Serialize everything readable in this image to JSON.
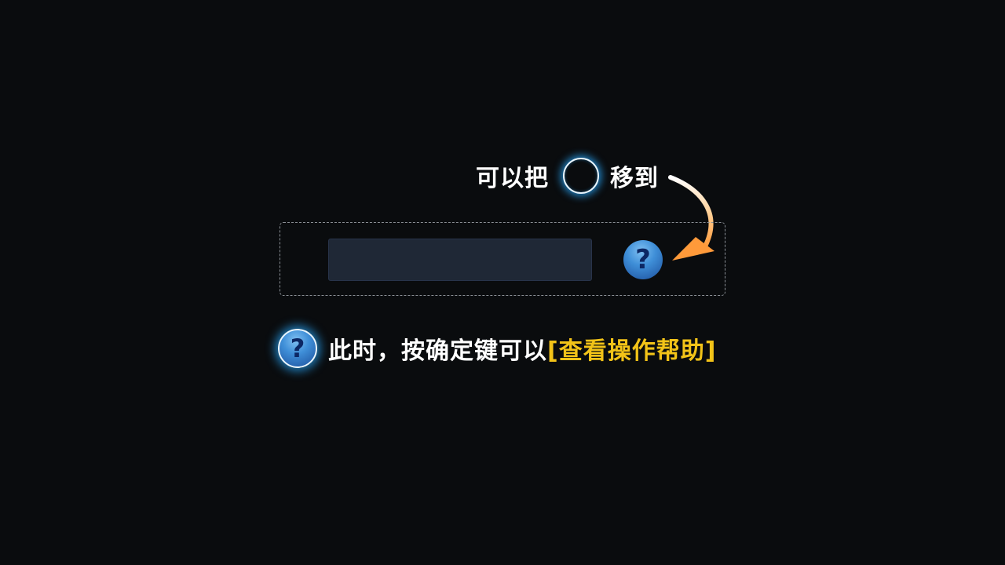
{
  "top_hint": {
    "prefix": "可以把",
    "suffix": "移到"
  },
  "help_button": {
    "icon": "question-icon",
    "symbol": "?"
  },
  "bottom_hint": {
    "text": "此时，按确定键可以",
    "highlight": "[查看操作帮助]"
  },
  "colors": {
    "background": "#0a0c0e",
    "input_bar": "#1f2836",
    "help_blue": "#3f8fd8",
    "glow": "#28aaff",
    "highlight": "#f2c318",
    "arrow": "#ffa94a"
  }
}
